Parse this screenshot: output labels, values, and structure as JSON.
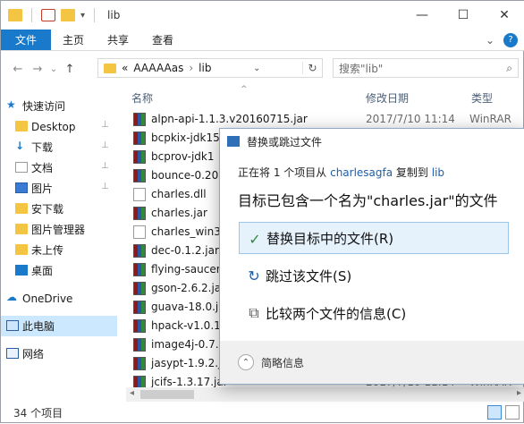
{
  "window": {
    "title": "lib",
    "caption": {
      "minimize": "—",
      "maximize": "☐",
      "close": "✕"
    }
  },
  "ribbon": {
    "file": "文件",
    "tabs": [
      "主页",
      "共享",
      "查看"
    ],
    "expand": "⌄",
    "help": "?"
  },
  "address": {
    "back": "←",
    "forward": "→",
    "history": "⌄",
    "up": "↑",
    "prefix": "«",
    "parts": [
      "AAAAAas",
      "lib"
    ],
    "sep": "›",
    "dropdown": "⌄",
    "refresh": "↻",
    "search_placeholder": "搜索\"lib\"",
    "search_icon": "⌕"
  },
  "nav": {
    "quick_access": "快速访问",
    "items": [
      {
        "label": "Desktop",
        "icon": "desktop-folder-icon",
        "pinned": true
      },
      {
        "label": "下载",
        "icon": "download-arrow-icon",
        "pinned": true
      },
      {
        "label": "文档",
        "icon": "document-icon",
        "pinned": true
      },
      {
        "label": "图片",
        "icon": "picture-icon",
        "pinned": true
      },
      {
        "label": "安下载",
        "icon": "folder-icon",
        "pinned": false
      },
      {
        "label": "图片管理器",
        "icon": "folder-icon",
        "pinned": false
      },
      {
        "label": "未上传",
        "icon": "folder-icon",
        "pinned": false
      },
      {
        "label": "桌面",
        "icon": "desktop-icon",
        "pinned": false
      }
    ],
    "onedrive": "OneDrive",
    "this_pc": "此电脑",
    "network": "网络",
    "pin_glyph": "📌"
  },
  "columns": {
    "name": "名称",
    "date": "修改日期",
    "type": "类型",
    "sort_glyph": "^"
  },
  "files": [
    {
      "name": "alpn-api-1.1.3.v20160715.jar",
      "date": "2017/7/10 11:14",
      "type": "WinRAR",
      "icon": "rar"
    },
    {
      "name": "bcpkix-jdk15",
      "date": "",
      "type": "",
      "icon": "rar"
    },
    {
      "name": "bcprov-jdk1",
      "date": "",
      "type": "",
      "icon": "rar"
    },
    {
      "name": "bounce-0.20",
      "date": "",
      "type": "",
      "icon": "rar"
    },
    {
      "name": "charles.dll",
      "date": "",
      "type": "",
      "icon": "doc"
    },
    {
      "name": "charles.jar",
      "date": "",
      "type": "",
      "icon": "rar"
    },
    {
      "name": "charles_win3",
      "date": "",
      "type": "",
      "icon": "doc"
    },
    {
      "name": "dec-0.1.2.jar",
      "date": "",
      "type": "",
      "icon": "rar"
    },
    {
      "name": "flying-saucer",
      "date": "",
      "type": "",
      "icon": "rar"
    },
    {
      "name": "gson-2.6.2.ja",
      "date": "",
      "type": "",
      "icon": "rar"
    },
    {
      "name": "guava-18.0.j",
      "date": "",
      "type": "",
      "icon": "rar"
    },
    {
      "name": "hpack-v1.0.1",
      "date": "",
      "type": "",
      "icon": "rar"
    },
    {
      "name": "image4j-0.7.",
      "date": "",
      "type": "",
      "icon": "rar"
    },
    {
      "name": "jasypt-1.9.2.j",
      "date": "",
      "type": "",
      "icon": "rar"
    },
    {
      "name": "jcifs-1.3.17.jar",
      "date": "2017/7/10 11:14",
      "type": "WinRAR",
      "icon": "rar"
    }
  ],
  "status": {
    "count": "34 个项目"
  },
  "dialog": {
    "title": "替换或跳过文件",
    "line1_pre": "正在将 1 个项目从 ",
    "line1_src": "charlesagfa",
    "line1_mid": " 复制到 ",
    "line1_dst": "lib",
    "line2": "目标已包含一个名为\"charles.jar\"的文件",
    "option_replace": "替换目标中的文件(R)",
    "option_skip": "跳过该文件(S)",
    "option_compare": "比较两个文件的信息(C)",
    "replace_glyph": "✓",
    "skip_glyph": "↻",
    "compare_glyph": "⧉",
    "more_glyph": "⌃",
    "more_info": "简略信息"
  },
  "colors": {
    "accent": "#1979ca",
    "selected_nav": "#cce8ff",
    "option_highlight": "#e5f1fb",
    "link": "#1f5fa8"
  }
}
